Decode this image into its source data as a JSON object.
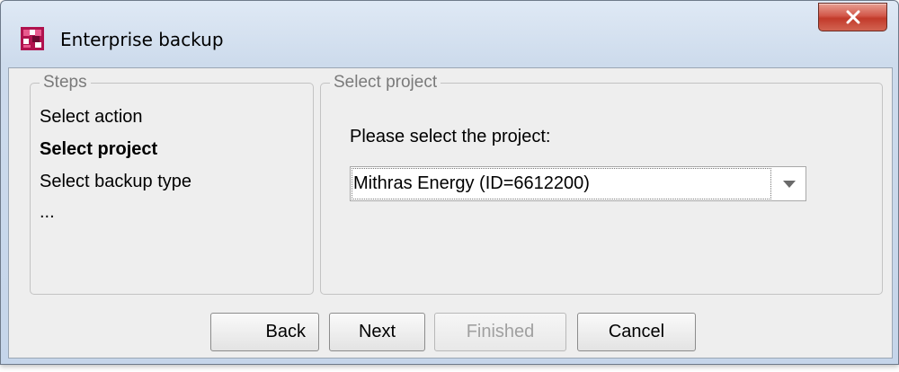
{
  "window": {
    "title": "Enterprise backup",
    "icon": "app-logo-icon",
    "close_icon": "close-icon",
    "accent_close_color": "#c8463a"
  },
  "steps": {
    "legend": "Steps",
    "items": [
      {
        "label": "Select action",
        "active": false
      },
      {
        "label": "Select project",
        "active": true
      },
      {
        "label": "Select backup type",
        "active": false
      },
      {
        "label": "...",
        "active": false
      }
    ]
  },
  "project": {
    "legend": "Select project",
    "prompt": "Please select the project:",
    "selected": "Mithras Energy (ID=6612200)",
    "dropdown_icon": "chevron-down-icon"
  },
  "buttons": {
    "back": "Back",
    "next": "Next",
    "finished": "Finished",
    "cancel": "Cancel"
  }
}
